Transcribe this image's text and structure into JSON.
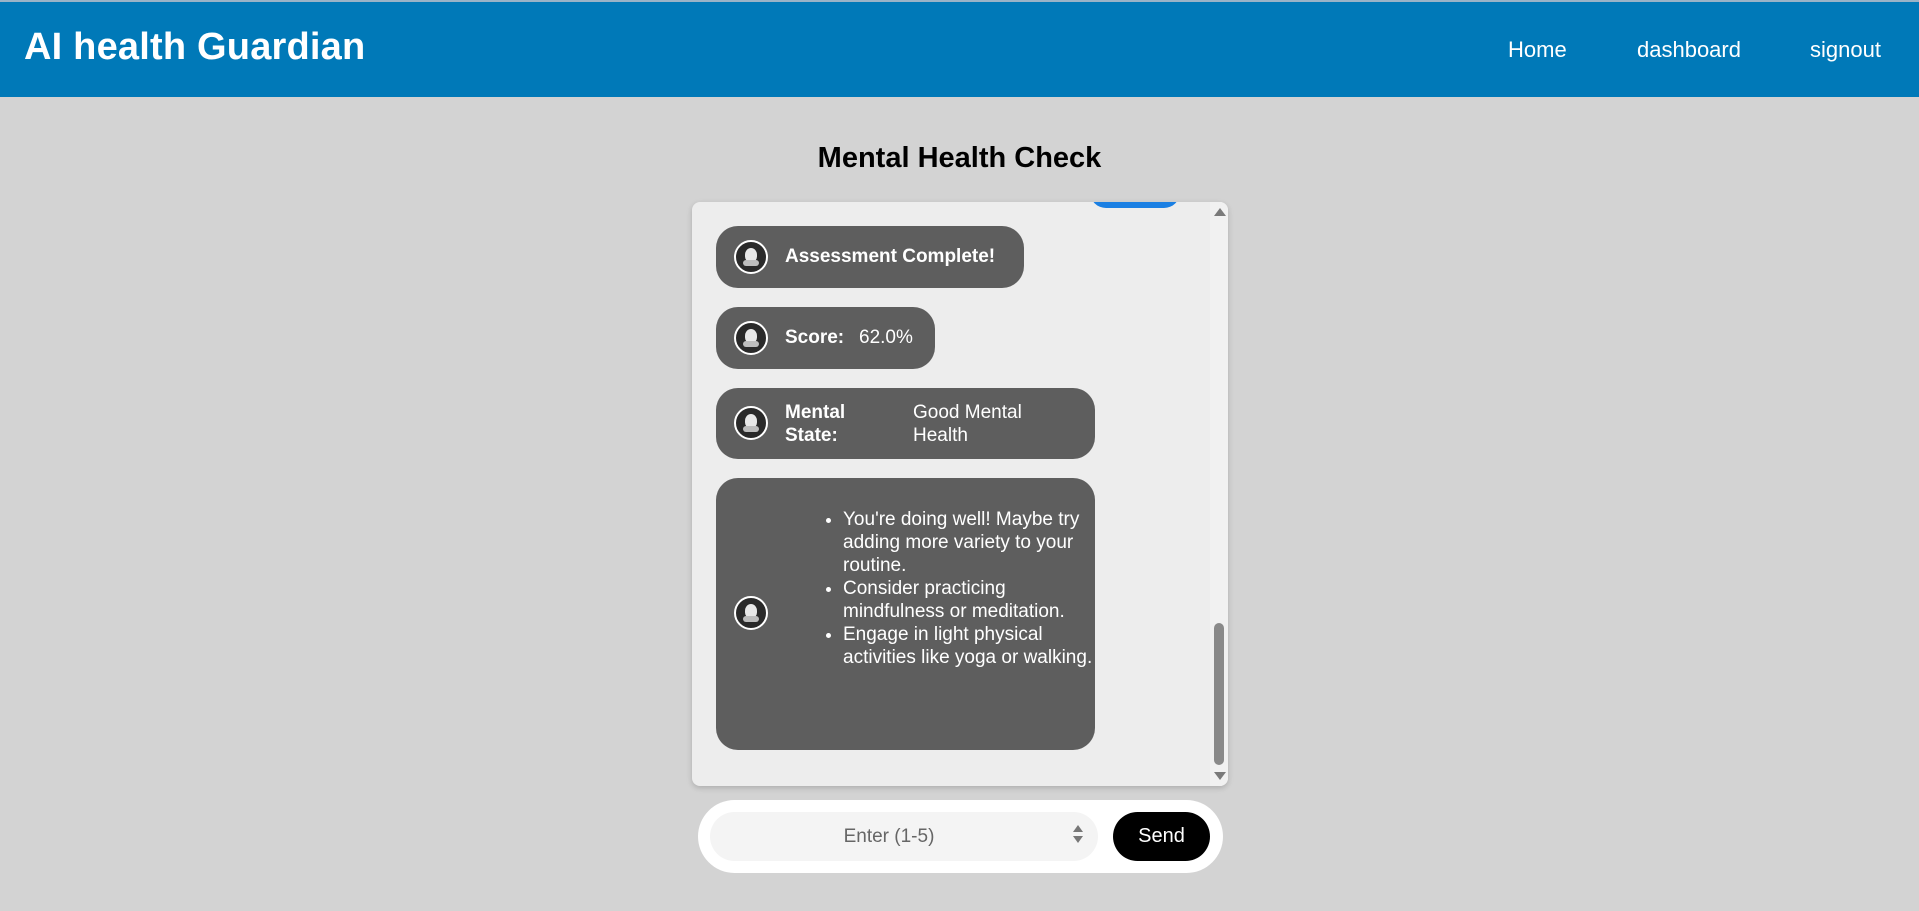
{
  "header": {
    "brand": "AI health Guardian",
    "nav": {
      "home": "Home",
      "dashboard": "dashboard",
      "signout": "signout"
    },
    "color": "#0079b8"
  },
  "page": {
    "title": "Mental Health Check"
  },
  "chat": {
    "messages": {
      "assessment": "Assessment Complete!",
      "score_label": "Score:",
      "score_value": "62.0%",
      "state_label": "Mental State:",
      "state_value": "Good Mental Health",
      "tips": [
        "You're doing well! Maybe try adding more variety to your routine.",
        "Consider practicing mindfulness or meditation.",
        "Engage in light physical activities like yoga or walking."
      ]
    },
    "bubble_color": "#5e5e5e",
    "icon": "bot-avatar-icon"
  },
  "input": {
    "placeholder": "Enter (1-5)",
    "send_label": "Send"
  }
}
